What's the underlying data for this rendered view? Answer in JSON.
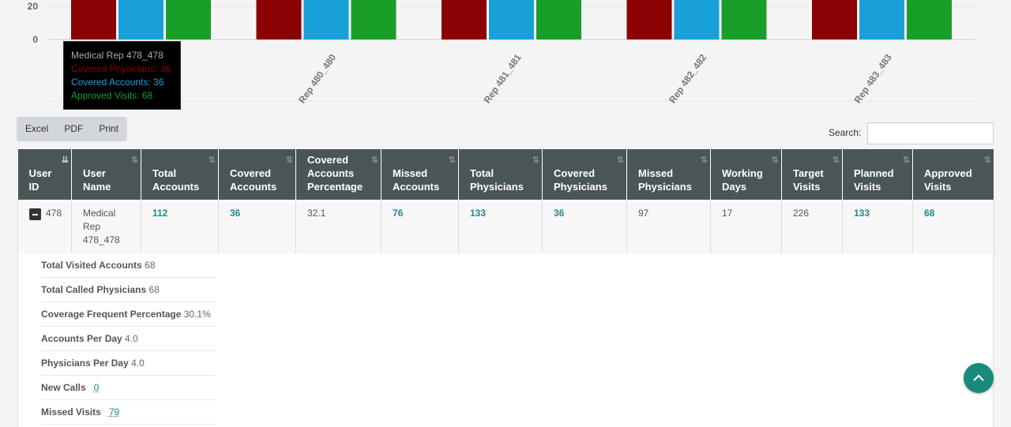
{
  "chart_data": {
    "type": "bar",
    "categories": [
      "Medical Rep 478_478",
      "Rep 480_480",
      "Rep 481_481",
      "Rep 482_482",
      "Rep 483_483"
    ],
    "series": [
      {
        "name": "Covered Physicians",
        "color": "#8b0000",
        "values": [
          36,
          null,
          null,
          null,
          null
        ]
      },
      {
        "name": "Covered Accounts",
        "color": "#1aa0d8",
        "values": [
          36,
          null,
          null,
          null,
          null
        ]
      },
      {
        "name": "Approved Visits",
        "color": "#1a9e2a",
        "values": [
          68,
          null,
          null,
          null,
          null
        ]
      }
    ],
    "y_ticks": [
      "0",
      "20"
    ],
    "tick_labels": [
      "Rep 480_480",
      "Rep 481_481",
      "Rep 482_482",
      "Rep 483_483"
    ],
    "grid": true
  },
  "tooltip": {
    "title": "Medical Rep 478_478",
    "physicians": "Covered Physicians: 36",
    "accounts": "Covered Accounts: 36",
    "visits": "Approved Visits: 68"
  },
  "toolbar": {
    "excel": "Excel",
    "pdf": "PDF",
    "print": "Print",
    "search_label": "Search:",
    "search_value": ""
  },
  "table": {
    "headers": [
      [
        "User",
        "ID"
      ],
      [
        "User",
        "Name"
      ],
      [
        "Total",
        "Accounts"
      ],
      [
        "Covered",
        "Accounts"
      ],
      [
        "Covered",
        "Accounts",
        "Percentage"
      ],
      [
        "Missed",
        "Accounts"
      ],
      [
        "Total",
        "Physicians"
      ],
      [
        "Covered",
        "Physicians"
      ],
      [
        "Missed",
        "Physicians"
      ],
      [
        "Working",
        "Days"
      ],
      [
        "Target",
        "Visits"
      ],
      [
        "Planned",
        "Visits"
      ],
      [
        "Approved",
        "Visits"
      ]
    ],
    "row": {
      "user_id": "478",
      "user_name": "Medical Rep 478_478",
      "total_accounts": "112",
      "covered_accounts": "36",
      "covered_pct": "32.1",
      "missed_accounts": "76",
      "total_physicians": "133",
      "covered_physicians": "36",
      "missed_physicians": "97",
      "working_days": "17",
      "target_visits": "226",
      "planned_visits": "133",
      "approved_visits": "68"
    }
  },
  "details": [
    {
      "label": "Total Visited Accounts",
      "value": "68"
    },
    {
      "label": "Total Called Physicians",
      "value": "68"
    },
    {
      "label": "Coverage Frequent Percentage",
      "value": "30.1%"
    },
    {
      "label": "Accounts Per Day",
      "value": "4.0"
    },
    {
      "label": "Physicians Per Day",
      "value": "4.0"
    },
    {
      "label": "New Calls",
      "value": "0",
      "link": true
    },
    {
      "label": "Missed Visits",
      "value": "79",
      "link": true
    }
  ]
}
